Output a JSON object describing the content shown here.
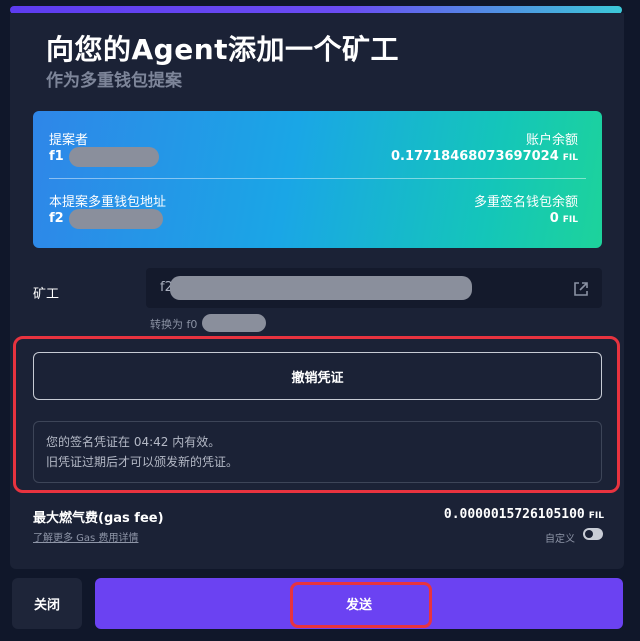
{
  "header": {
    "title": "向您的Agent添加一个矿工",
    "subtitle": "作为多重钱包提案"
  },
  "card": {
    "proposer_label": "提案者",
    "proposer_value": "f1",
    "balance_label": "账户余额",
    "balance_value": "0.17718468073697024",
    "balance_unit": "FIL",
    "multisig_label": "本提案多重钱包地址",
    "multisig_value": "f2",
    "multisig_balance_label": "多重签名钱包余额",
    "multisig_balance_value": "0",
    "multisig_balance_unit": "FIL"
  },
  "miner": {
    "label": "矿工",
    "value_prefix": "f2",
    "convert_text": "转换为 f0",
    "external_icon": "external-link-icon"
  },
  "revoke": {
    "button_label": "撤销凭证",
    "info_line1": "您的签名凭证在 04:42 内有效。",
    "info_line2": "旧凭证过期后才可以颁发新的凭证。"
  },
  "gas": {
    "label": "最大燃气费(gas fee)",
    "link": "了解更多 Gas 费用详情",
    "value": "0.0000015726105100",
    "unit": "FIL",
    "custom_label": "自定义",
    "custom_enabled": false
  },
  "footer": {
    "close_label": "关闭",
    "send_label": "发送"
  },
  "colors": {
    "accent": "#6b42f2",
    "highlight": "#e8333f",
    "card_start": "#2f86e8",
    "card_end": "#1dd39b"
  }
}
